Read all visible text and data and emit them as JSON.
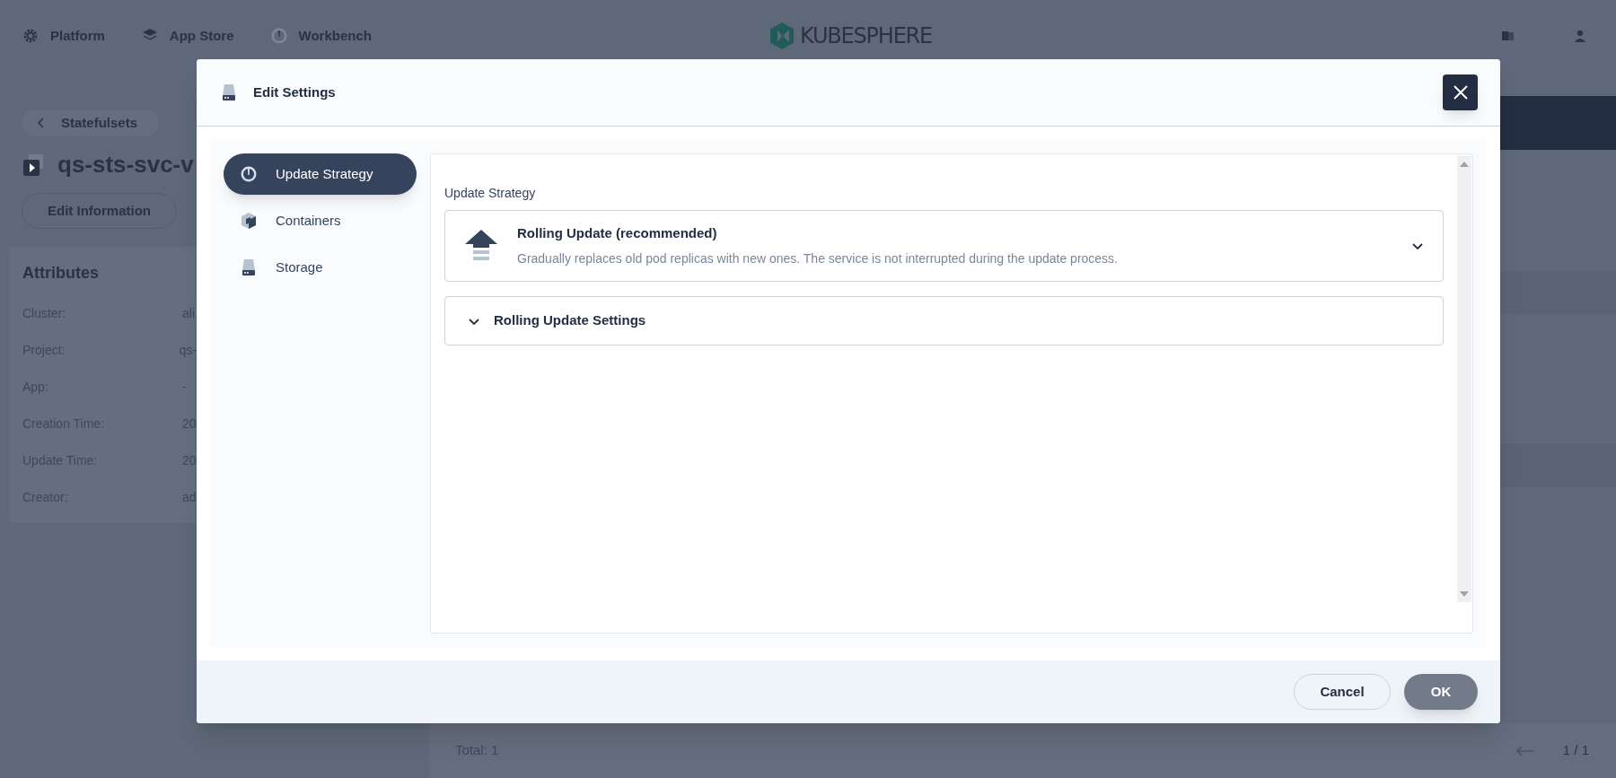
{
  "top_nav": {
    "items": [
      {
        "label": "Platform",
        "kind": "gear"
      },
      {
        "label": "App Store",
        "kind": "layers"
      },
      {
        "label": "Workbench",
        "kind": "gauge"
      }
    ],
    "logo_text": "KUBESPHERE"
  },
  "breadcrumb": "Statefulsets",
  "resource_title": "qs-sts-svc-v",
  "actions": [
    "Edit Information"
  ],
  "attributes": {
    "title": "Attributes",
    "rows": [
      {
        "label": "Cluster:",
        "value": "ali"
      },
      {
        "label": "Project:",
        "value": "qs-"
      },
      {
        "label": "App:",
        "value": "-"
      },
      {
        "label": "Creation Time:",
        "value": "20"
      },
      {
        "label": "Update Time:",
        "value": "20"
      },
      {
        "label": "Creator:",
        "value": "ad"
      }
    ]
  },
  "list_footer": {
    "total": "Total: 1",
    "page": "1 / 1"
  },
  "modal": {
    "title": "Edit Settings",
    "nav": [
      {
        "label": "Update Strategy",
        "selected": true,
        "kind": "gauge"
      },
      {
        "label": "Containers",
        "selected": false,
        "kind": "cube"
      },
      {
        "label": "Storage",
        "selected": false,
        "kind": "disk"
      }
    ],
    "section_label": "Update Strategy",
    "strategy": {
      "title": "Rolling Update (recommended)",
      "description": "Gradually replaces old pod replicas with new ones. The service is not interrupted during the update process."
    },
    "settings": {
      "title": "Rolling Update Settings"
    },
    "buttons": [
      {
        "label": "Cancel",
        "kind": "secondary"
      },
      {
        "label": "OK",
        "kind": "primary"
      }
    ]
  }
}
